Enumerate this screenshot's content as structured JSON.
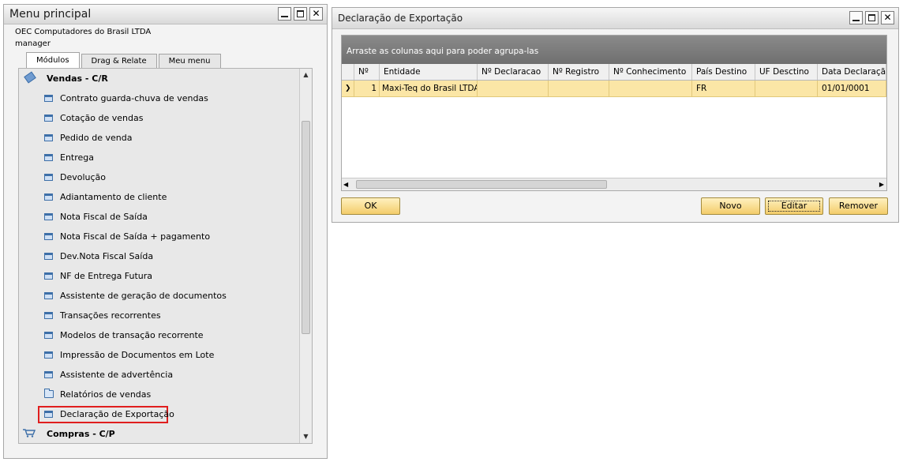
{
  "left_window": {
    "title": "Menu principal",
    "company": "OEC Computadores do Brasil LTDA",
    "user": "manager",
    "tabs": [
      {
        "label": "Módulos",
        "active": true
      },
      {
        "label": "Drag & Relate",
        "active": false
      },
      {
        "label": "Meu menu",
        "active": false
      }
    ],
    "module_vendas": "Vendas - C/R",
    "items": [
      {
        "label": "Contrato guarda-chuva de vendas",
        "icon": "form-icon"
      },
      {
        "label": "Cotação de vendas",
        "icon": "form-icon"
      },
      {
        "label": "Pedido de venda",
        "icon": "form-icon"
      },
      {
        "label": "Entrega",
        "icon": "form-icon"
      },
      {
        "label": "Devolução",
        "icon": "form-icon"
      },
      {
        "label": "Adiantamento de cliente",
        "icon": "form-icon"
      },
      {
        "label": "Nota Fiscal de Saída",
        "icon": "form-icon"
      },
      {
        "label": "Nota Fiscal de Saída + pagamento",
        "icon": "form-icon"
      },
      {
        "label": "Dev.Nota Fiscal Saída",
        "icon": "form-icon"
      },
      {
        "label": "NF de Entrega Futura",
        "icon": "form-icon"
      },
      {
        "label": "Assistente de geração de documentos",
        "icon": "form-icon"
      },
      {
        "label": "Transações recorrentes",
        "icon": "form-icon"
      },
      {
        "label": "Modelos de transação recorrente",
        "icon": "form-icon"
      },
      {
        "label": "Impressão de Documentos em Lote",
        "icon": "form-icon"
      },
      {
        "label": "Assistente de advertência",
        "icon": "form-icon"
      },
      {
        "label": "Relatórios de vendas",
        "icon": "folder-icon"
      },
      {
        "label": "Declaração de Exportação",
        "icon": "form-icon",
        "highlighted": true
      }
    ],
    "module_compras": "Compras - C/P",
    "highlight_color": "#e01e1e"
  },
  "right_window": {
    "title": "Declaração de Exportação",
    "group_hint": "Arraste as colunas aqui para poder agrupa-las",
    "columns": [
      "Nº",
      "Entidade",
      "Nº Declaracao",
      "Nº Registro",
      "Nº Conhecimento",
      "País Destino",
      "UF Desctino",
      "Data Declaração"
    ],
    "rows": [
      {
        "no": "1",
        "entidade": "Maxi-Teq do Brasil LTDA",
        "declaracao": "",
        "registro": "",
        "conhecimento": "",
        "pais": "FR",
        "uf": "",
        "data": "01/01/0001"
      }
    ],
    "buttons": {
      "ok": "OK",
      "novo": "Novo",
      "editar": "Editar",
      "remover": "Remover"
    },
    "row_color": "#fbe6a6",
    "button_color": "#f3cc6a"
  }
}
